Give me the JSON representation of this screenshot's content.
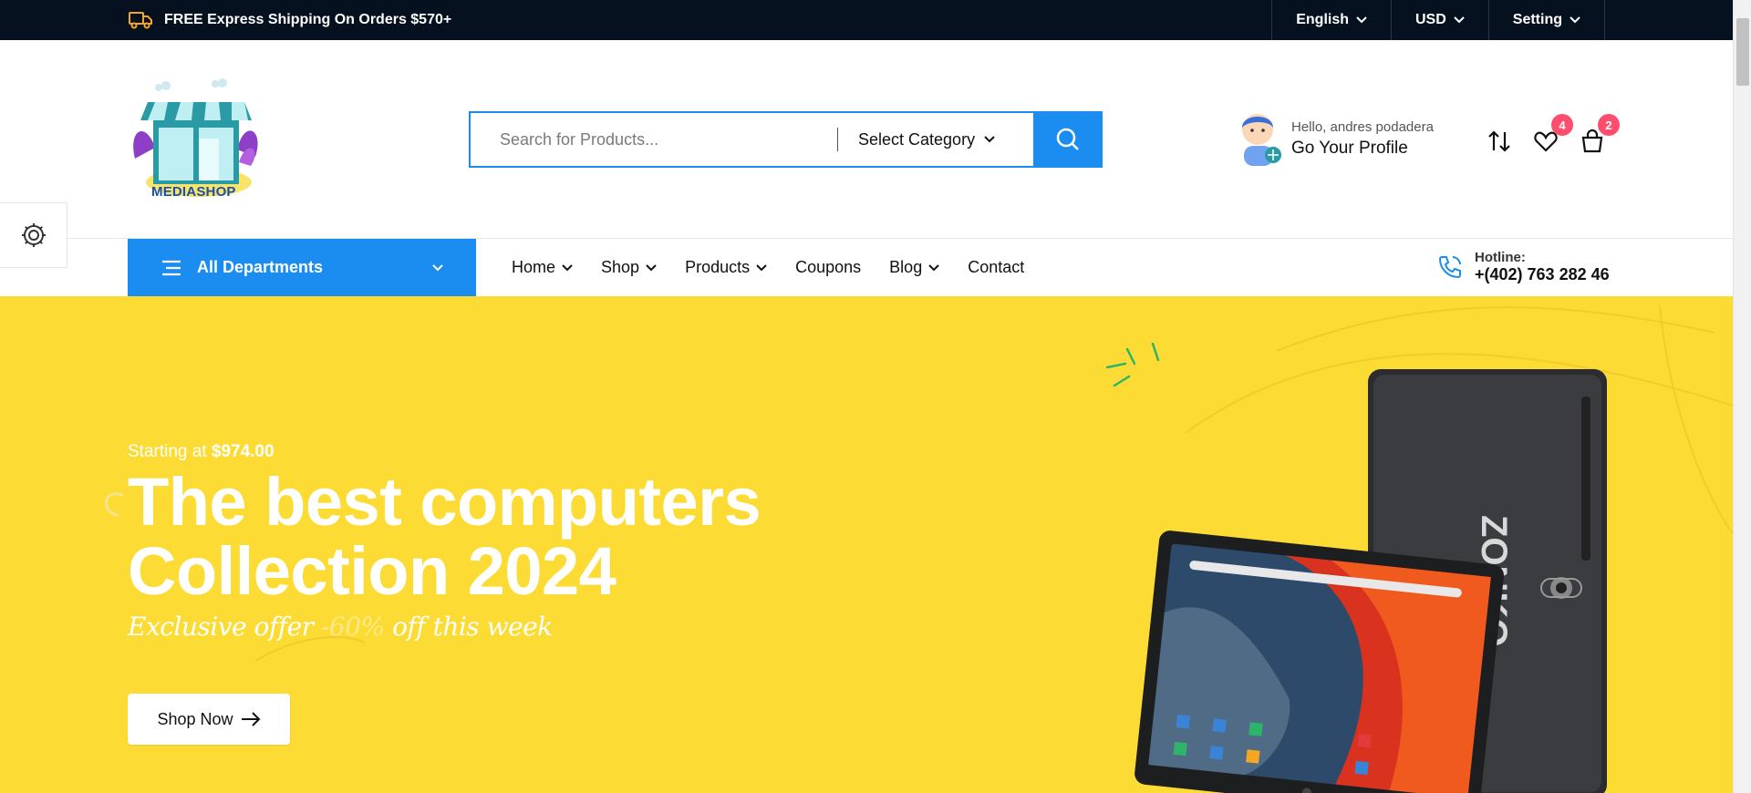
{
  "topbar": {
    "shipping_text": "FREE Express Shipping On Orders $570+",
    "language": "English",
    "currency": "USD",
    "setting": "Setting"
  },
  "header": {
    "logo_text": "MEDIASHOP",
    "search": {
      "placeholder": "Search for Products...",
      "category": "Select Category"
    },
    "profile": {
      "hello": "Hello, andres podadera",
      "link": "Go Your Profile"
    },
    "wishlist_count": "4",
    "cart_count": "2"
  },
  "nav": {
    "departments": "All Departments",
    "items": [
      {
        "label": "Home",
        "dropdown": true
      },
      {
        "label": "Shop",
        "dropdown": true
      },
      {
        "label": "Products",
        "dropdown": true
      },
      {
        "label": "Coupons",
        "dropdown": false
      },
      {
        "label": "Blog",
        "dropdown": true
      },
      {
        "label": "Contact",
        "dropdown": false
      }
    ],
    "hotline_label": "Hotline:",
    "hotline_number": "+(402) 763 282 46"
  },
  "hero": {
    "starting_prefix": "Starting at",
    "starting_price": "$974.00",
    "title_line1": "The best computers",
    "title_line2": "Collection 2024",
    "offer_prefix": "Exclusive offer",
    "offer_percent": "-60%",
    "offer_suffix": "off this week",
    "cta": "Shop Now",
    "tablet_brand": "ZONKO"
  },
  "colors": {
    "topbar_bg": "#06111f",
    "accent_blue": "#1c8df0",
    "hero_bg": "#fcdc34",
    "badge": "#ff4d6d"
  },
  "icons": [
    "truck-icon",
    "chevron-down-icon",
    "search-icon",
    "avatar",
    "compare-icon",
    "heart-icon",
    "bag-icon",
    "gear-icon",
    "menu-icon",
    "phone-icon",
    "arrow-right-icon"
  ]
}
